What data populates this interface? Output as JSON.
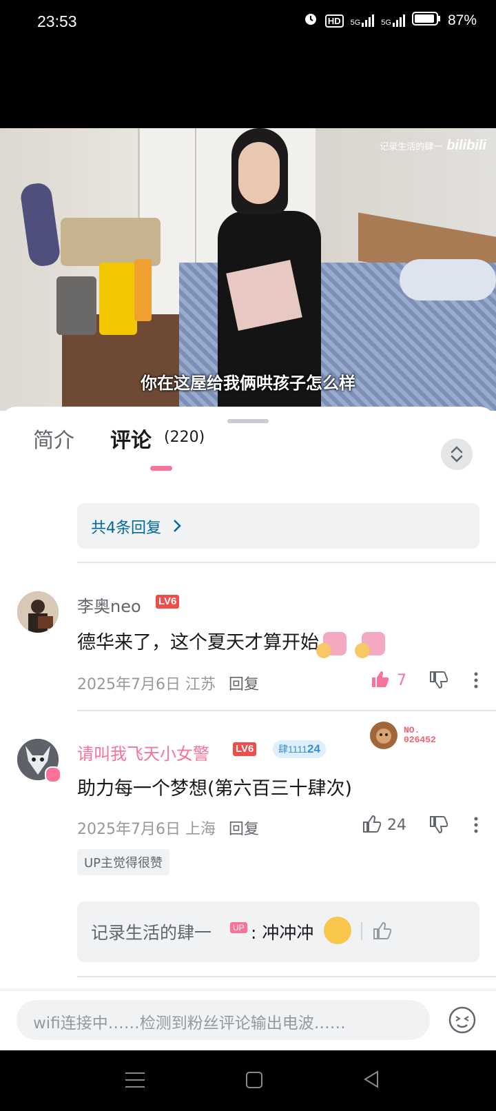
{
  "status_bar": {
    "time": "23:53",
    "hd_label": "HD",
    "sig1": "5G",
    "sig2": "5G",
    "battery": "87%"
  },
  "video": {
    "watermark_text": "记录生活的肆一",
    "watermark_brand": "bilibili",
    "subtitle": "你在这屋给我俩哄孩子怎么样"
  },
  "tabs": {
    "intro": "简介",
    "comments": "评论",
    "comments_count": "(220)"
  },
  "replies_link": "共4条回复",
  "comments": [
    {
      "username": "李奥neo",
      "level": "LV6",
      "text": "德华来了，这个夏天才算开始",
      "date": "2025年7月6日",
      "location": "江苏",
      "reply": "回复",
      "likes": "7",
      "liked": true
    },
    {
      "username": "请叫我飞天小女警",
      "level": "LV6",
      "fan_badge": "肆1111",
      "fan_level": "24",
      "decoration_no": "NO.",
      "decoration_num": "026452",
      "text": "助力每一个梦想(第六百三十肆次)",
      "date": "2025年7月6日",
      "location": "上海",
      "reply": "回复",
      "likes": "24",
      "liked": false,
      "up_tag": "UP主觉得很赞"
    }
  ],
  "up_reply": {
    "name": "记录生活的肆一",
    "badge": "UP",
    "text": ": 冲冲冲"
  },
  "input": {
    "placeholder": "wifi连接中……检测到粉丝评论输出电波……"
  },
  "colors": {
    "accent": "#fb7299",
    "link": "#00699d",
    "level": "#f04c49"
  }
}
